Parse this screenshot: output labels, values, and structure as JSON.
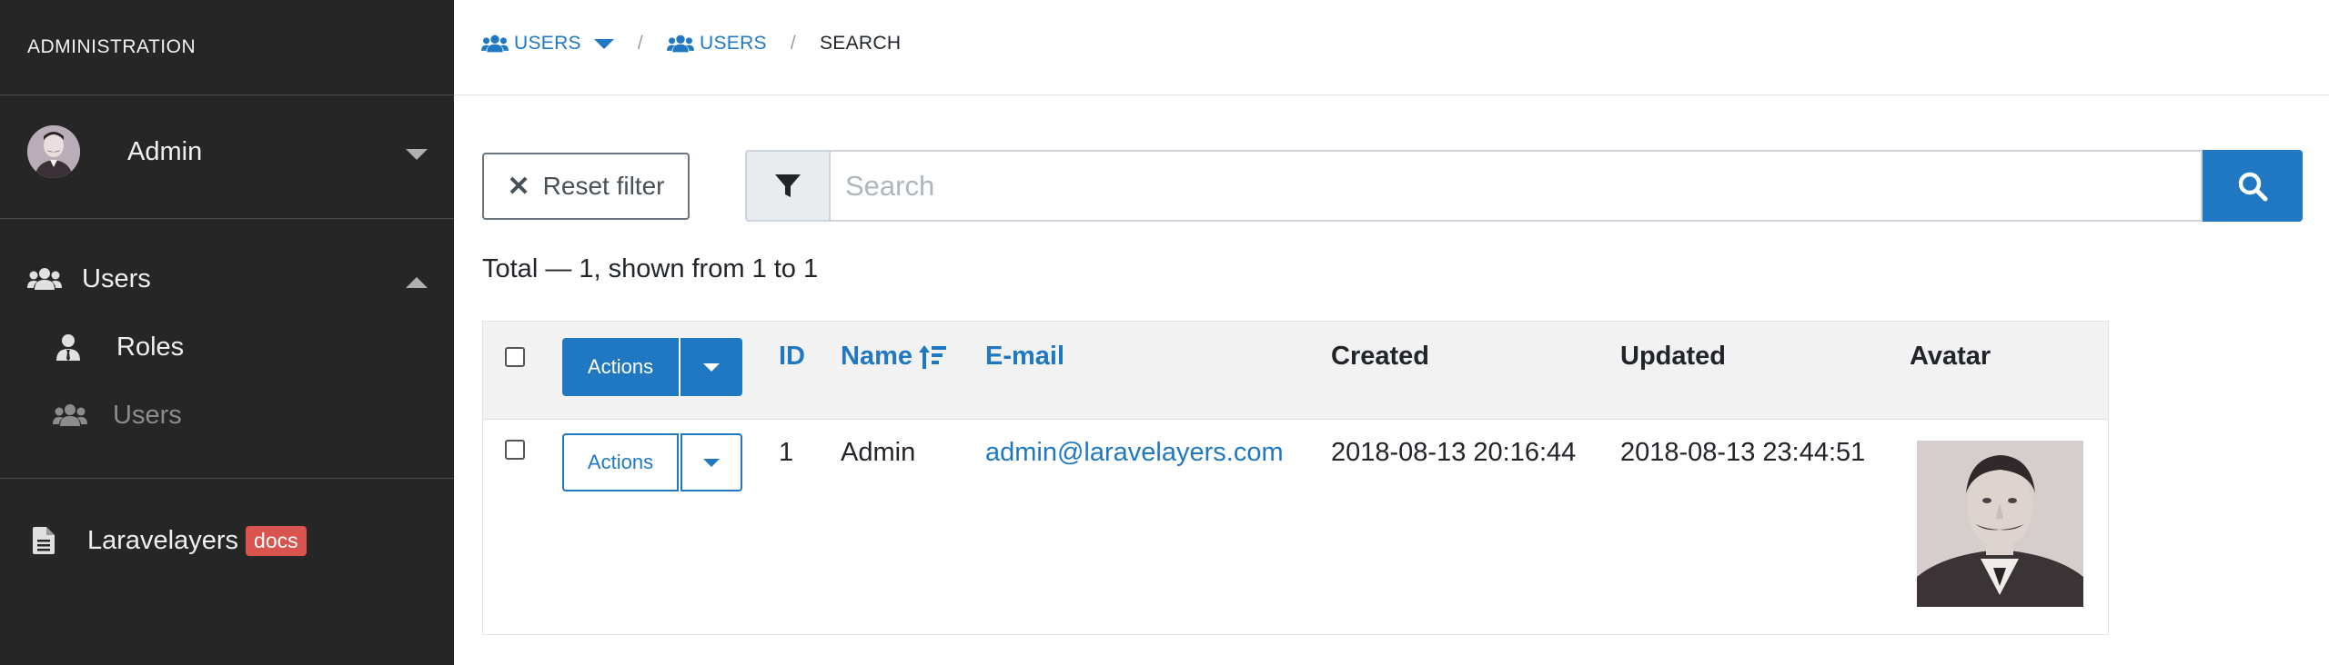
{
  "sidebar": {
    "title": "ADMINISTRATION",
    "user_name": "Admin",
    "menu": {
      "users_label": "Users",
      "roles_label": "Roles",
      "sub_users_label": "Users",
      "laravelayers_label": "Laravelayers",
      "docs_badge": "docs"
    }
  },
  "breadcrumb": {
    "item1": "USERS",
    "item2": "USERS",
    "current": "SEARCH",
    "separator": "/"
  },
  "toolbar": {
    "reset_label": "Reset filter",
    "search_placeholder": "Search"
  },
  "summary": "Total — 1, shown from 1 to 1",
  "table": {
    "header": {
      "actions_label": "Actions",
      "id": "ID",
      "name": "Name",
      "email": "E-mail",
      "created": "Created",
      "updated": "Updated",
      "avatar": "Avatar"
    },
    "rows": [
      {
        "actions_label": "Actions",
        "id": "1",
        "name": "Admin",
        "email": "admin@laravelayers.com",
        "created": "2018-08-13 20:16:44",
        "updated": "2018-08-13 23:44:51"
      }
    ]
  },
  "colors": {
    "sidebar_bg": "#262626",
    "primary": "#1f78c1",
    "badge": "#d9534f",
    "header_bg": "#f2f2f2"
  },
  "icons": [
    "users-icon",
    "user-tie-icon",
    "file-icon",
    "filter-icon",
    "search-icon",
    "times-icon",
    "sort-icon",
    "caret-down-icon",
    "caret-up-icon"
  ]
}
